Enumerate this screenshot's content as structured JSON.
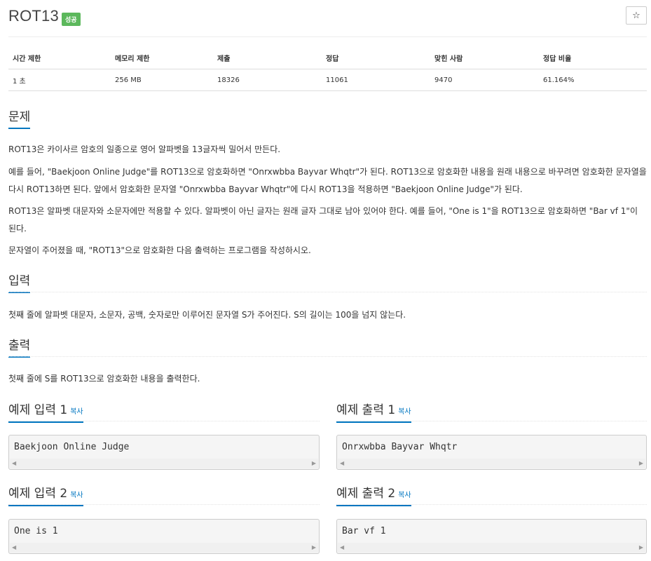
{
  "problem": {
    "title": "ROT13",
    "badge": "성공",
    "star_icon": "☆"
  },
  "stats": {
    "headers": [
      "시간 제한",
      "메모리 제한",
      "제출",
      "정답",
      "맞힌 사람",
      "정답 비율"
    ],
    "values": [
      "1 초",
      "256 MB",
      "18326",
      "11061",
      "9470",
      "61.164%"
    ]
  },
  "sections": {
    "problem": {
      "title": "문제",
      "paragraphs": [
        "ROT13은 카이사르 암호의 일종으로 영어 알파벳을 13글자씩 밀어서 만든다.",
        "예를 들어, \"Baekjoon Online Judge\"를 ROT13으로 암호화하면 \"Onrxwbba Bayvar Whqtr\"가 된다. ROT13으로 암호화한 내용을 원래 내용으로 바꾸려면 암호화한 문자열을 다시 ROT13하면 된다. 앞에서 암호화한 문자열 \"Onrxwbba Bayvar Whqtr\"에 다시 ROT13을 적용하면 \"Baekjoon Online Judge\"가 된다.",
        "ROT13은 알파벳 대문자와 소문자에만 적용할 수 있다. 알파벳이 아닌 글자는 원래 글자 그대로 남아 있어야 한다. 예를 들어, \"One is 1\"을 ROT13으로 암호화하면 \"Bar vf 1\"이 된다.",
        "문자열이 주어졌을 때, \"ROT13\"으로 암호화한 다음 출력하는 프로그램을 작성하시오."
      ]
    },
    "input": {
      "title": "입력",
      "text": "첫째 줄에 알파벳 대문자, 소문자, 공백, 숫자로만 이루어진 문자열 S가 주어진다. S의 길이는 100을 넘지 않는다."
    },
    "output": {
      "title": "출력",
      "text": "첫째 줄에 S를 ROT13으로 암호화한 내용을 출력한다."
    }
  },
  "samples": {
    "copy_label": "복사",
    "in1": {
      "title": "예제 입력 1",
      "code": "Baekjoon Online Judge"
    },
    "out1": {
      "title": "예제 출력 1",
      "code": "Onrxwbba Bayvar Whqtr"
    },
    "in2": {
      "title": "예제 입력 2",
      "code": "One is 1"
    },
    "out2": {
      "title": "예제 출력 2",
      "code": "Bar vf 1"
    }
  },
  "colors": {
    "accent": "#0076c0",
    "success": "#5cb85c"
  }
}
